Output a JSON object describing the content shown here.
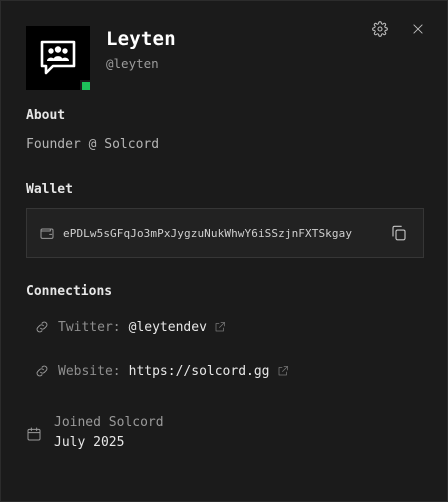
{
  "profile": {
    "display_name": "Leyten",
    "username": "@leyten",
    "status_color": "#1ec25a"
  },
  "about": {
    "title": "About",
    "text": "Founder @ Solcord"
  },
  "wallet": {
    "title": "Wallet",
    "address": "ePDLw5sGFqJo3mPxJygzuNukWhwY6iSSzjnFXTSkgay"
  },
  "connections": {
    "title": "Connections",
    "items": [
      {
        "label": "Twitter:",
        "value": "@leytendev",
        "icon": "link-icon"
      },
      {
        "label": "Website:",
        "value": "https://solcord.gg",
        "icon": "link-icon"
      }
    ]
  },
  "joined": {
    "label": "Joined Solcord",
    "date": "July 2025"
  },
  "icons": [
    "gear-icon",
    "close-icon",
    "wallet-icon",
    "copy-icon",
    "link-icon",
    "external-link-icon",
    "calendar-icon"
  ]
}
